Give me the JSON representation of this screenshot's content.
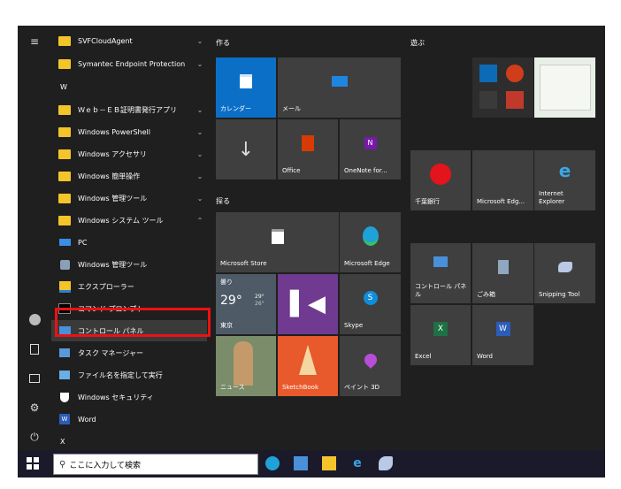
{
  "applist": {
    "rows": [
      {
        "label": "SVFCloudAgent"
      },
      {
        "label": "Symantec Endpoint Protection"
      },
      {
        "label": "W"
      },
      {
        "label": "Ｗｅｂ－ＥＢ証明書発行アプリ"
      },
      {
        "label": "Windows PowerShell"
      },
      {
        "label": "Windows アクセサリ"
      },
      {
        "label": "Windows 簡単操作"
      },
      {
        "label": "Windows 管理ツール"
      },
      {
        "label": "Windows システム ツール"
      },
      {
        "label": "PC"
      },
      {
        "label": "Windows 管理ツール"
      },
      {
        "label": "エクスプローラー"
      },
      {
        "label": "コマンド プロンプト"
      },
      {
        "label": "コントロール パネル"
      },
      {
        "label": "タスク マネージャー"
      },
      {
        "label": "ファイル名を指定して実行"
      },
      {
        "label": "Windows セキュリティ"
      },
      {
        "label": "Word"
      },
      {
        "label": "X"
      }
    ]
  },
  "groups": {
    "create": "作る",
    "explore": "探る",
    "play": "遊ぶ"
  },
  "tiles": {
    "calendar": "カレンダー",
    "mail": "メール",
    "office": "Office",
    "onenote": "OneNote for...",
    "store": "Microsoft Store",
    "edge": "Microsoft Edge",
    "weather_label": "曇り",
    "weather_temp": "29°",
    "weather_hi": "29°",
    "weather_lo": "26°",
    "weather_city": "東京",
    "skype": "Skype",
    "news": "ニュース",
    "sketchbook": "SketchBook",
    "paint3d": "ペイント 3D",
    "chiba": "千葉銀行",
    "edge2": "Microsoft Edg...",
    "ie": "Internet Explorer",
    "control": "コントロール パネル",
    "recycle": "ごみ箱",
    "snipping": "Snipping Tool",
    "excel": "Excel",
    "word": "Word"
  },
  "taskbar": {
    "search_placeholder": "ここに入力して検索"
  },
  "colors": {
    "highlight": "#e11111",
    "tile": "#3f3f3f",
    "calendar_accent": "#0b6fc7"
  }
}
